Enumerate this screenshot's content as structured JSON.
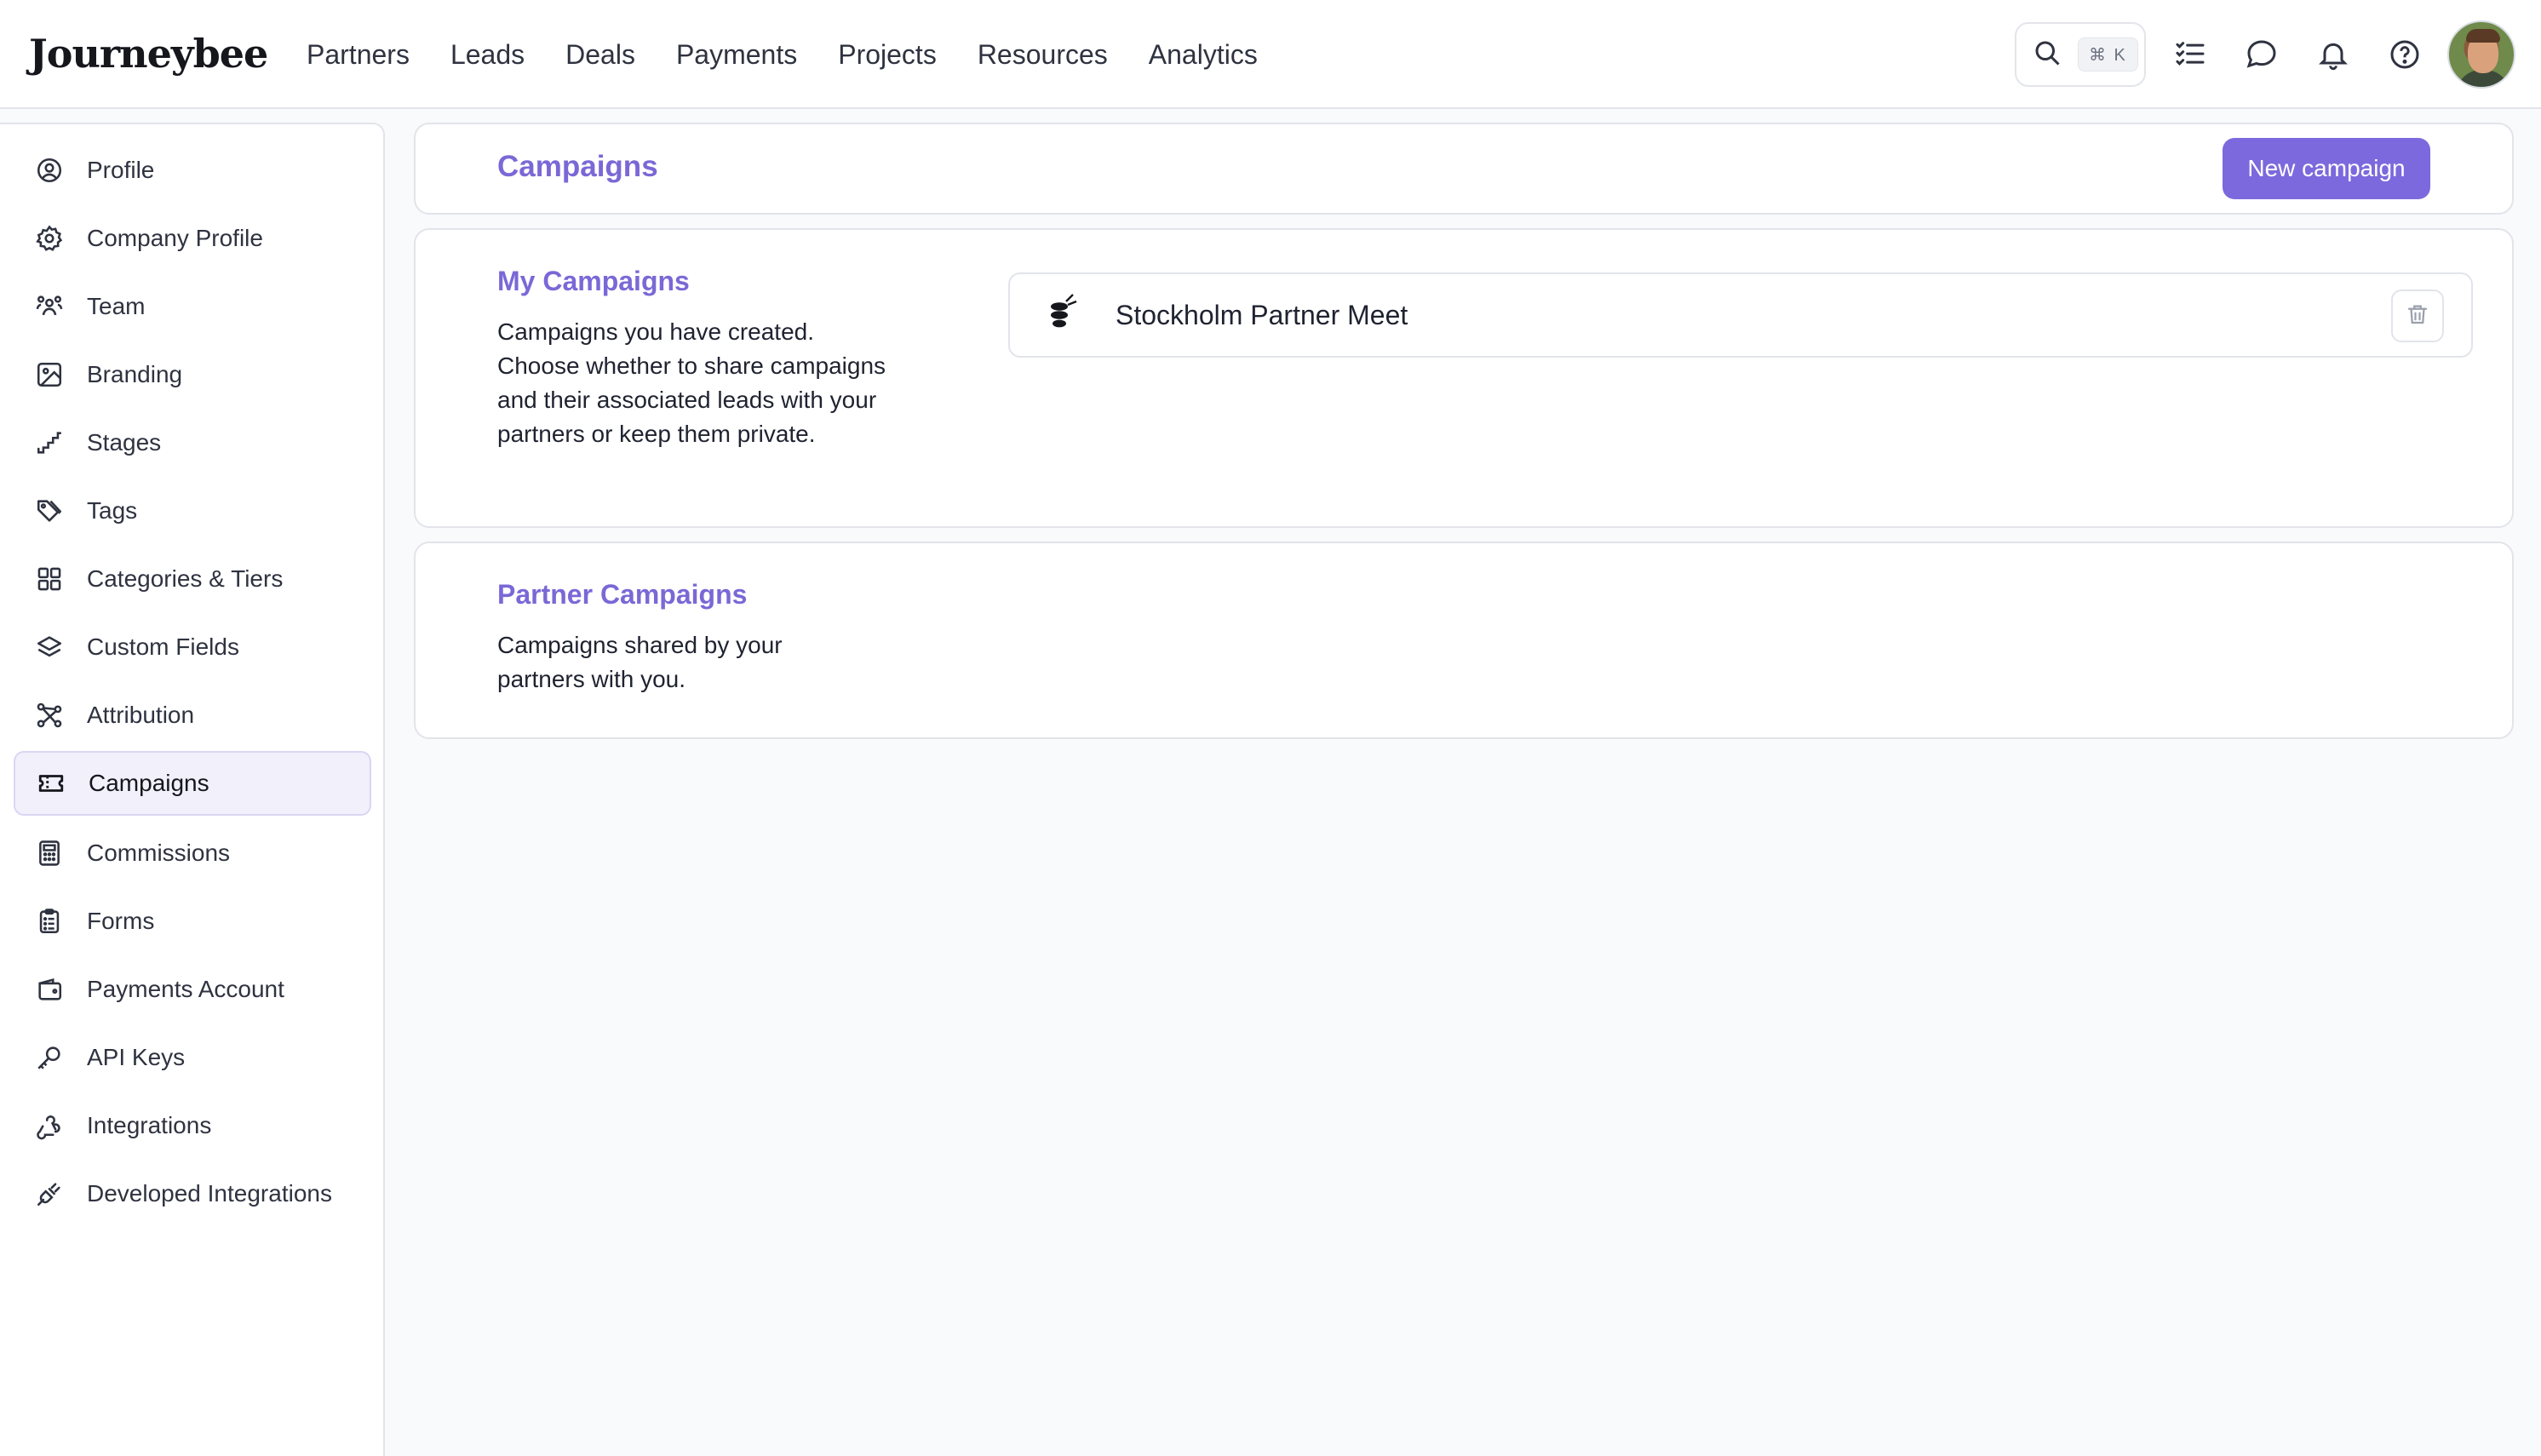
{
  "brand": {
    "logo_text": "Journeybee"
  },
  "nav": {
    "items": [
      {
        "label": "Partners"
      },
      {
        "label": "Leads"
      },
      {
        "label": "Deals"
      },
      {
        "label": "Payments"
      },
      {
        "label": "Projects"
      },
      {
        "label": "Resources"
      },
      {
        "label": "Analytics"
      }
    ]
  },
  "topbar": {
    "search_shortcut": "⌘ K",
    "icons": [
      "search-icon",
      "tasks-icon",
      "chat-icon",
      "bell-icon",
      "help-icon",
      "avatar"
    ]
  },
  "sidebar": {
    "active": "Campaigns",
    "items": [
      {
        "label": "Profile",
        "icon": "user-circle-icon"
      },
      {
        "label": "Company Profile",
        "icon": "gear-icon"
      },
      {
        "label": "Team",
        "icon": "team-icon"
      },
      {
        "label": "Branding",
        "icon": "image-icon"
      },
      {
        "label": "Stages",
        "icon": "stairs-icon"
      },
      {
        "label": "Tags",
        "icon": "tags-icon"
      },
      {
        "label": "Categories & Tiers",
        "icon": "grid-icon"
      },
      {
        "label": "Custom Fields",
        "icon": "layers-icon"
      },
      {
        "label": "Attribution",
        "icon": "route-icon"
      },
      {
        "label": "Campaigns",
        "icon": "ticket-icon"
      },
      {
        "label": "Commissions",
        "icon": "calculator-icon"
      },
      {
        "label": "Forms",
        "icon": "clipboard-icon"
      },
      {
        "label": "Payments Account",
        "icon": "wallet-icon"
      },
      {
        "label": "API Keys",
        "icon": "key-icon"
      },
      {
        "label": "Integrations",
        "icon": "webhook-icon"
      },
      {
        "label": "Developed Integrations",
        "icon": "plug-icon"
      }
    ]
  },
  "page": {
    "title": "Campaigns",
    "new_button": "New campaign"
  },
  "my_campaigns": {
    "title": "My Campaigns",
    "description": "Campaigns you have created. Choose whether to share campaigns and their associated leads with your partners or keep them private.",
    "items": [
      {
        "name": "Stockholm Partner Meet"
      }
    ]
  },
  "partner_campaigns": {
    "title": "Partner Campaigns",
    "description": "Campaigns shared by your partners with you."
  },
  "colors": {
    "accent": "#7c69dd",
    "accent_text": "#7b68d6",
    "active_bg": "#f1f0fb"
  }
}
